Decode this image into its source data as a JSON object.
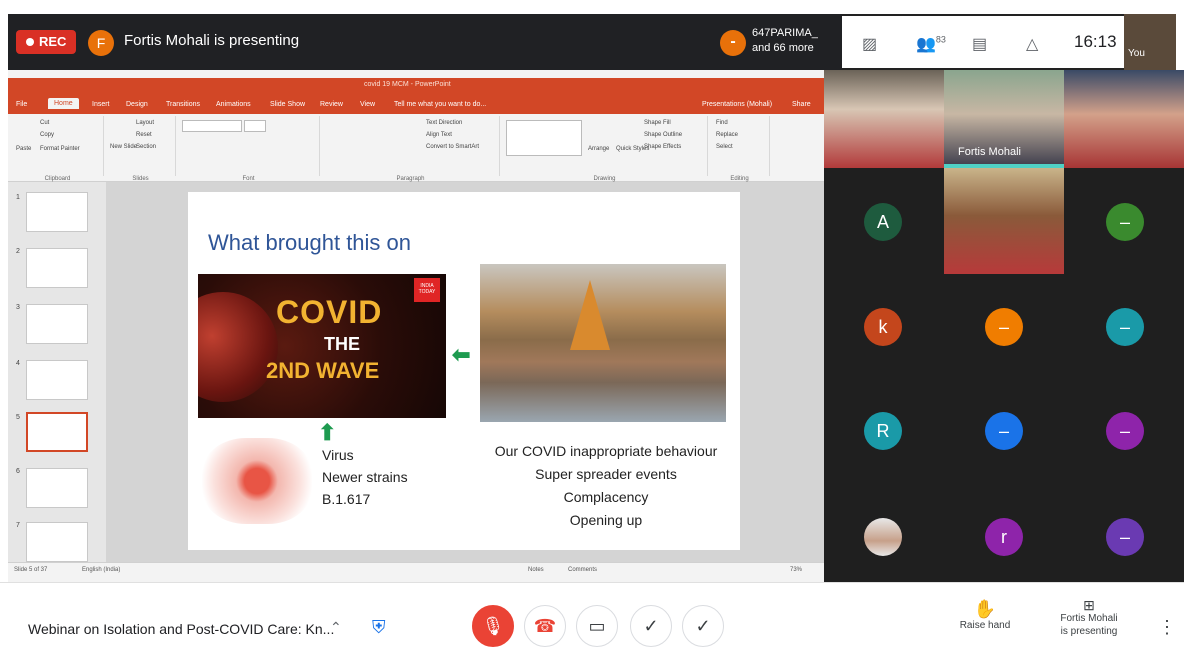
{
  "topbar": {
    "rec_label": "REC",
    "presenter_initial": "F",
    "presenter_title": "Fortis Mohali is presenting",
    "participant_initial": "-",
    "participant_name": "647PARIMA_",
    "participant_more": "and 66 more",
    "people_count": "83",
    "clock": "16:13",
    "you_label": "You"
  },
  "ppt": {
    "window_title": "covid 19 MCM - PowerPoint",
    "tabs": [
      "File",
      "Home",
      "Insert",
      "Design",
      "Transitions",
      "Animations",
      "Slide Show",
      "Review",
      "View",
      "Tell me what you want to do..."
    ],
    "presentations_label": "Presentations (Mohali)",
    "share_label": "Share",
    "ribbon_groups": [
      "Clipboard",
      "Slides",
      "Font",
      "Paragraph",
      "Drawing",
      "Editing"
    ],
    "ribbon_items": {
      "cut": "Cut",
      "copy": "Copy",
      "paste": "Paste",
      "format_painter": "Format Painter",
      "new_slide": "New Slide",
      "layout": "Layout",
      "reset": "Reset",
      "section": "Section",
      "text_direction": "Text Direction",
      "align_text": "Align Text",
      "convert": "Convert to SmartArt",
      "arrange": "Arrange",
      "quick_styles": "Quick Styles",
      "shape_fill": "Shape Fill",
      "shape_outline": "Shape Outline",
      "shape_effects": "Shape Effects",
      "find": "Find",
      "replace": "Replace",
      "select": "Select"
    },
    "thumb_numbers": [
      "1",
      "2",
      "3",
      "4",
      "5",
      "6",
      "7"
    ],
    "status": {
      "slide": "Slide 5 of 37",
      "language": "English (India)",
      "notes": "Notes",
      "comments": "Comments",
      "zoom": "73%"
    }
  },
  "slide": {
    "heading": "What brought this on",
    "covid_line1": "COVID",
    "covid_line2": "THE",
    "covid_line3": "2ND WAVE",
    "badge": "INDIA TODAY",
    "virus_lines": [
      "Virus",
      "Newer strains",
      "B.1.617"
    ],
    "cause_lines": [
      "Our COVID inappropriate behaviour",
      "Super spreader events",
      "Complacency",
      "Opening up"
    ]
  },
  "grid": {
    "highlight_label": "Fortis Mohali",
    "avatars": [
      {
        "letter": "A",
        "color": "#1e5b3e"
      },
      {
        "letter": "–",
        "color": "#3a8a2e"
      },
      {
        "letter": "k",
        "color": "#c4461c"
      },
      {
        "letter": "–",
        "color": "#f07d00"
      },
      {
        "letter": "–",
        "color": "#1a9aa8"
      },
      {
        "letter": "R",
        "color": "#1a9aa8"
      },
      {
        "letter": "–",
        "color": "#1a73e8"
      },
      {
        "letter": "–",
        "color": "#8e24aa"
      },
      {
        "letter": "",
        "color": "#e0e0e0"
      },
      {
        "letter": "r",
        "color": "#8e24aa"
      },
      {
        "letter": "–",
        "color": "#6a3ab2"
      }
    ]
  },
  "bottombar": {
    "meeting_title": "Webinar on Isolation and Post-COVID Care: Kn...",
    "raise_hand": "Raise hand",
    "presenting_line1": "Fortis Mohali",
    "presenting_line2": "is presenting"
  }
}
